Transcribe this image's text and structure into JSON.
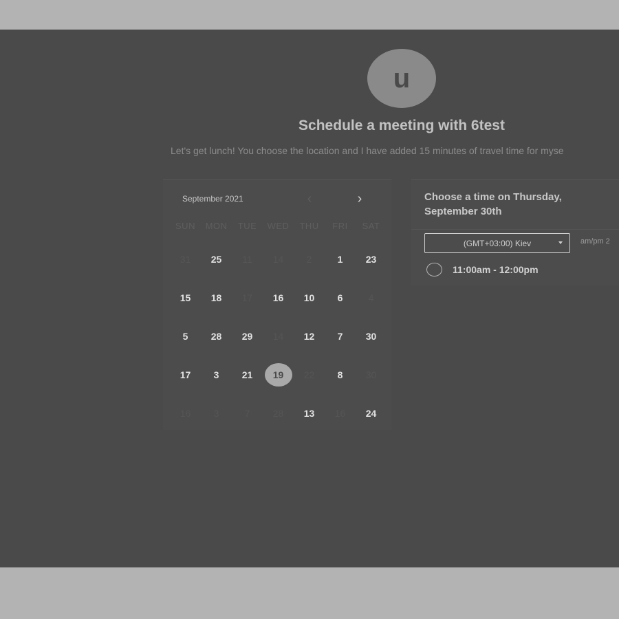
{
  "header": {
    "avatar_letter": "u",
    "title": "Schedule a meeting with 6test",
    "description": "Let's get lunch! You choose the location and I have added 15 minutes of travel time for myse"
  },
  "calendar": {
    "month_label": "September 2021",
    "prev_icon": "chevron-left-icon",
    "next_icon": "chevron-right-icon",
    "weekdays": [
      "SUN",
      "MON",
      "TUE",
      "WED",
      "THU",
      "FRI",
      "SAT"
    ],
    "weeks": [
      [
        {
          "d": "31",
          "avail": false
        },
        {
          "d": "25",
          "avail": true
        },
        {
          "d": "11",
          "avail": false
        },
        {
          "d": "14",
          "avail": false
        },
        {
          "d": "2",
          "avail": false
        },
        {
          "d": "1",
          "avail": true
        },
        {
          "d": "23",
          "avail": true
        }
      ],
      [
        {
          "d": "15",
          "avail": true
        },
        {
          "d": "18",
          "avail": true
        },
        {
          "d": "17",
          "avail": false
        },
        {
          "d": "16",
          "avail": true
        },
        {
          "d": "10",
          "avail": true
        },
        {
          "d": "6",
          "avail": true
        },
        {
          "d": "4",
          "avail": false
        }
      ],
      [
        {
          "d": "5",
          "avail": true
        },
        {
          "d": "28",
          "avail": true
        },
        {
          "d": "29",
          "avail": true
        },
        {
          "d": "14",
          "avail": false
        },
        {
          "d": "12",
          "avail": true
        },
        {
          "d": "7",
          "avail": true
        },
        {
          "d": "30",
          "avail": true
        }
      ],
      [
        {
          "d": "17",
          "avail": true
        },
        {
          "d": "3",
          "avail": true
        },
        {
          "d": "21",
          "avail": true
        },
        {
          "d": "19",
          "avail": true,
          "selected": true
        },
        {
          "d": "22",
          "avail": false
        },
        {
          "d": "8",
          "avail": true
        },
        {
          "d": "30",
          "avail": false
        }
      ],
      [
        {
          "d": "16",
          "avail": false
        },
        {
          "d": "3",
          "avail": false
        },
        {
          "d": "7",
          "avail": false
        },
        {
          "d": "28",
          "avail": false
        },
        {
          "d": "13",
          "avail": true
        },
        {
          "d": "16",
          "avail": false
        },
        {
          "d": "24",
          "avail": true
        }
      ]
    ]
  },
  "times": {
    "title": "Choose a time on Thursday, September 30th",
    "timezone": "(GMT+03:00) Kiev",
    "format_toggle": "am/pm  2",
    "slots": [
      "11:00am - 12:00pm"
    ]
  },
  "colors": {
    "backdrop": "#b3b3b3",
    "overlay": "#4a4a4a",
    "selected_day": "#a9a9a9"
  }
}
